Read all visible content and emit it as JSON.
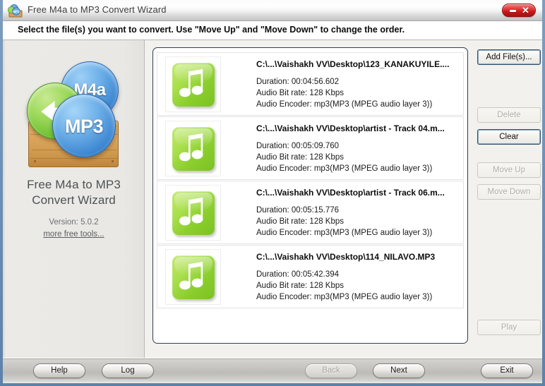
{
  "window": {
    "title": "Free M4a to MP3 Convert Wizard",
    "icon": "app-crate-icon",
    "close_label": "×",
    "minimize_label": "–"
  },
  "instruction": {
    "text": "Select the file(s) you want to convert. Use \"Move Up\" and \"Move Down\" to change the order."
  },
  "sidebar": {
    "logo": {
      "bubble_m4a": "M4a",
      "bubble_mp3": "MP3",
      "arrow_icon": "convert-arrow-icon"
    },
    "product_name_line1": "Free M4a to MP3",
    "product_name_line2": "Convert Wizard",
    "version": "Version: 5.0.2",
    "more_tools_link": "more free tools..."
  },
  "file_list": [
    {
      "icon": "music-note-icon",
      "path": "C:\\...\\Vaishakh VV\\Desktop\\123_KANAKUYILE....",
      "duration": "Duration: 00:04:56.602",
      "bitrate": "Audio Bit rate: 128 Kbps",
      "encoder": "Audio Encoder: mp3(MP3 (MPEG audio layer 3))"
    },
    {
      "icon": "music-note-icon",
      "path": "C:\\...\\Vaishakh VV\\Desktop\\artist - Track 04.m...",
      "duration": "Duration: 00:05:09.760",
      "bitrate": "Audio Bit rate: 128 Kbps",
      "encoder": "Audio Encoder: mp3(MP3 (MPEG audio layer 3))"
    },
    {
      "icon": "music-note-icon",
      "path": "C:\\...\\Vaishakh VV\\Desktop\\artist - Track 06.m...",
      "duration": "Duration: 00:05:15.776",
      "bitrate": "Audio Bit rate: 128 Kbps",
      "encoder": "Audio Encoder: mp3(MP3 (MPEG audio layer 3))"
    },
    {
      "icon": "music-note-icon",
      "path": "C:\\...\\Vaishakh VV\\Desktop\\114_NILAVO.MP3",
      "duration": "Duration: 00:05:42.394",
      "bitrate": "Audio Bit rate: 128 Kbps",
      "encoder": "Audio Encoder: mp3(MP3 (MPEG audio layer 3))"
    }
  ],
  "side_buttons": {
    "add_files": {
      "label": "Add File(s)...",
      "accesskey": "A",
      "enabled": true,
      "focused": true
    },
    "delete": {
      "label": "Delete",
      "accesskey": "D",
      "enabled": false,
      "focused": false
    },
    "clear": {
      "label": "Clear",
      "accesskey": "C",
      "enabled": true,
      "focused": true
    },
    "move_up": {
      "label": "Move Up",
      "accesskey": "o",
      "enabled": false,
      "focused": false
    },
    "move_down": {
      "label": "Move Down",
      "accesskey": "o",
      "enabled": false,
      "focused": false
    },
    "play": {
      "label": "Play",
      "accesskey": "l",
      "enabled": false,
      "focused": false
    }
  },
  "bottom_buttons": {
    "help": {
      "label": "Help",
      "enabled": true
    },
    "log": {
      "label": "Log",
      "enabled": true
    },
    "back": {
      "label": "Back",
      "enabled": false
    },
    "next": {
      "label": "Next",
      "enabled": true
    },
    "exit": {
      "label": "Exit",
      "enabled": true
    }
  },
  "colors": {
    "titlebar_text": "#3d3d3d",
    "close_red": "#c71818",
    "window_border": "#6b8fb5",
    "accent_green": "#8ccf2f",
    "bubble_blue": "#3f88d2",
    "list_border": "#2e3f4f",
    "sidebar_bg": "#e9e8e4"
  }
}
